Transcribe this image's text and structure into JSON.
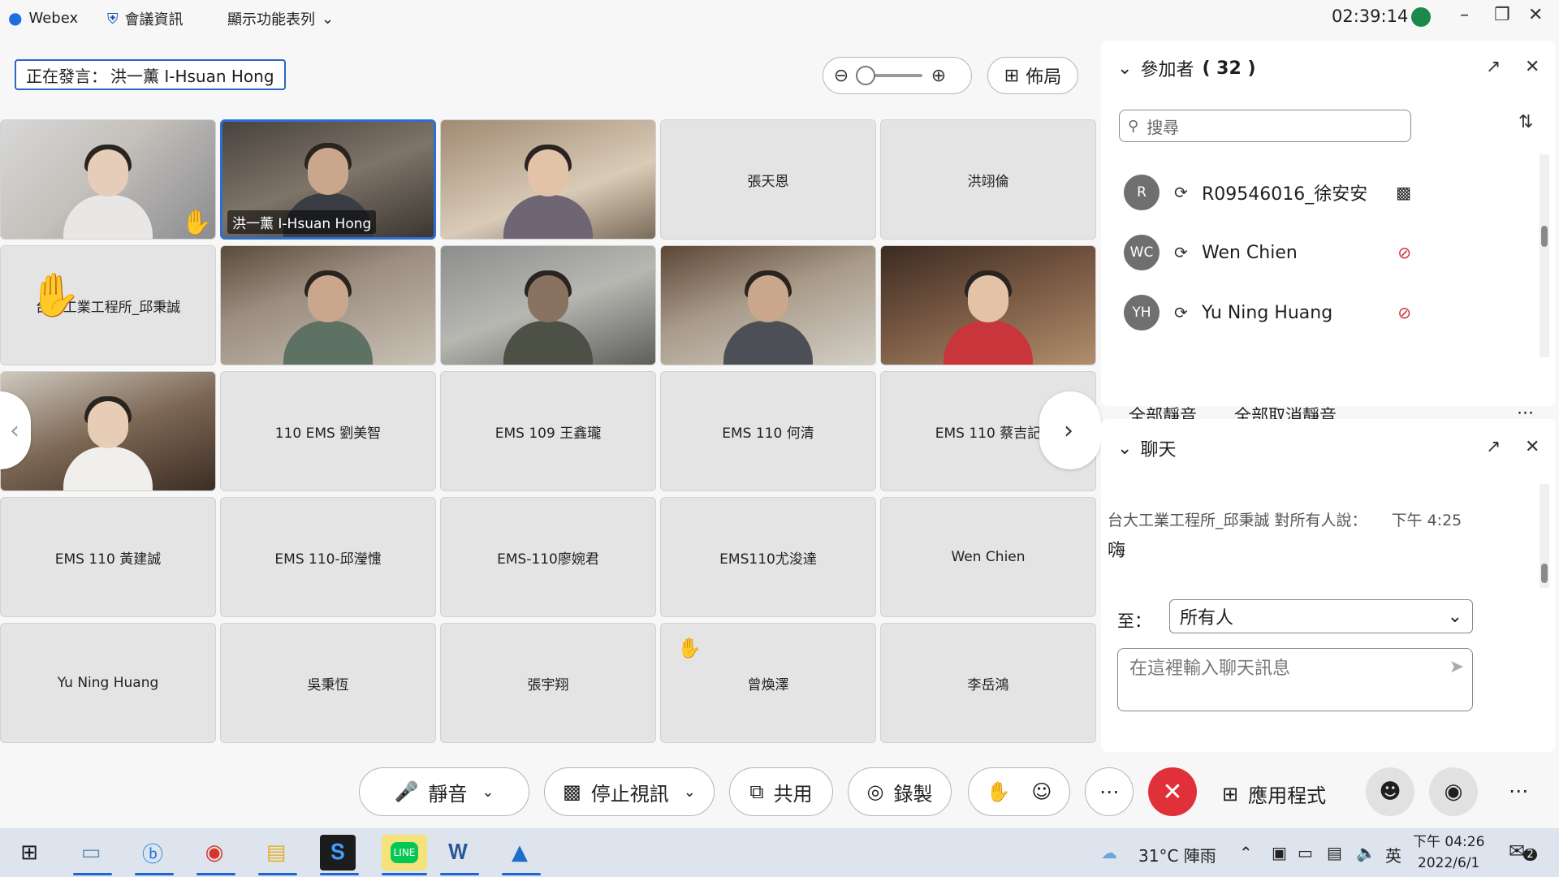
{
  "titlebar": {
    "app": "Webex",
    "meeting_info": "會議資訊",
    "menu": "顯示功能表列",
    "time": "02:39:14"
  },
  "speaker": {
    "label": "正在發言：",
    "name": "洪一薰 I-Hsuan Hong"
  },
  "layout_label": "佈局",
  "tiles": {
    "t2_name": "洪一薰 I-Hsuan Hong",
    "t4": "張天恩",
    "t5": "洪翊倫",
    "t6": "台大工業工程所_邱秉誠",
    "t12": "110 EMS 劉美智",
    "t13": "EMS 109 王鑫瓏",
    "t14": "EMS 110 何清",
    "t15": "EMS 110 蔡吉記",
    "t16": "EMS 110 黃建誠",
    "t17": "EMS 110-邱瀅懥",
    "t18": "EMS-110廖婉君",
    "t19": "EMS110尤浚達",
    "t20": "Wen Chien",
    "t21": "Yu Ning Huang",
    "t22": "吳秉恆",
    "t23": "張宇翔",
    "t24": "曾煥澤",
    "t25": "李岳鴻"
  },
  "participants": {
    "title": "參加者",
    "count": "( 32 )",
    "search_placeholder": "搜尋",
    "rows": [
      {
        "initials": "R",
        "name": "R09546016_徐安安"
      },
      {
        "initials": "WC",
        "name": "Wen Chien"
      },
      {
        "initials": "YH",
        "name": "Yu Ning Huang"
      }
    ],
    "mute_all": "全部靜音",
    "unmute_all": "全部取消靜音"
  },
  "chat": {
    "title": "聊天",
    "sender": "台大工業工程所_邱秉誠 對所有人說：",
    "time": "下午 4:25",
    "message": "嗨",
    "to_label": "至：",
    "to_value": "所有人",
    "input_placeholder": "在這裡輸入聊天訊息"
  },
  "controls": {
    "mute": "靜音",
    "stop_video": "停止視訊",
    "share": "共用",
    "record": "錄製",
    "apps": "應用程式"
  },
  "taskbar": {
    "weather": "31°C 陣雨",
    "ime": "英",
    "clock_time": "下午 04:26",
    "clock_date": "2022/6/1",
    "notif_count": "2"
  },
  "colors": {
    "accent": "#2d6ed0",
    "end": "#e0303a"
  }
}
